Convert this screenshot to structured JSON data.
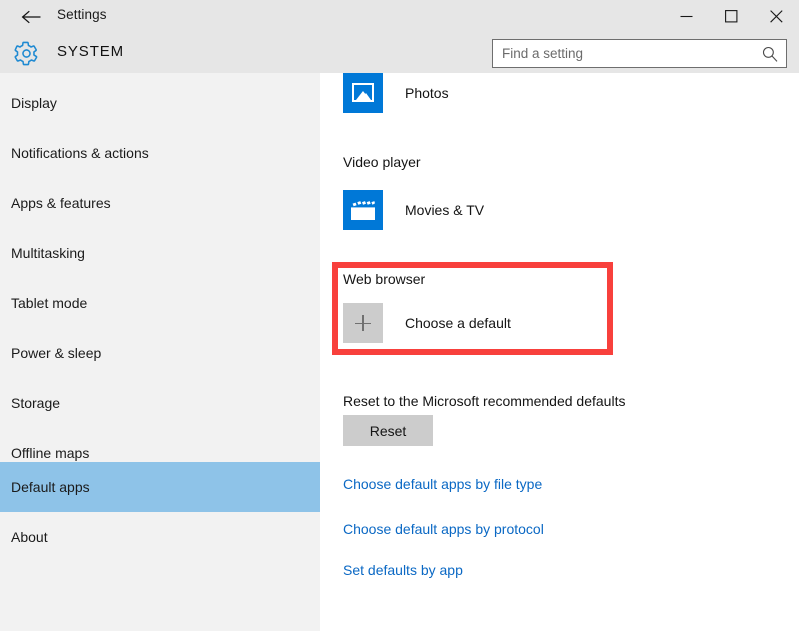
{
  "window": {
    "title": "Settings",
    "back_icon": "back-arrow-icon",
    "minimize_label": "–",
    "maximize_label": "☐",
    "close_label": "✕"
  },
  "header": {
    "category": "SYSTEM",
    "gear_icon": "gear-icon"
  },
  "search": {
    "placeholder": "Find a setting",
    "value": "",
    "icon": "search-icon"
  },
  "sidebar": {
    "selected": "Default apps",
    "selected_color": "#8ec3e8",
    "items": [
      {
        "label": "Display"
      },
      {
        "label": "Notifications & actions"
      },
      {
        "label": "Apps & features"
      },
      {
        "label": "Multitasking"
      },
      {
        "label": "Tablet mode"
      },
      {
        "label": "Power & sleep"
      },
      {
        "label": "Storage"
      },
      {
        "label": "Offline maps"
      },
      {
        "label": "Default apps"
      },
      {
        "label": "About"
      }
    ]
  },
  "main": {
    "photo_viewer_app": "Photos",
    "video_player_heading": "Video player",
    "video_player_app": "Movies & TV",
    "web_browser_heading": "Web browser",
    "web_browser_app": "Choose a default",
    "reset_heading": "Reset to the Microsoft recommended defaults",
    "reset_button": "Reset",
    "links": [
      {
        "label": "Choose default apps by file type"
      },
      {
        "label": "Choose default apps by protocol"
      },
      {
        "label": "Set defaults by app"
      }
    ]
  },
  "annotation": {
    "color": "#f8403c",
    "target": "Web browser"
  },
  "colors": {
    "accent": "#0078d7",
    "link": "#0a68c4",
    "chrome": "#e6e6e6",
    "sidebar": "#f2f2f2",
    "button": "#cccccc"
  }
}
